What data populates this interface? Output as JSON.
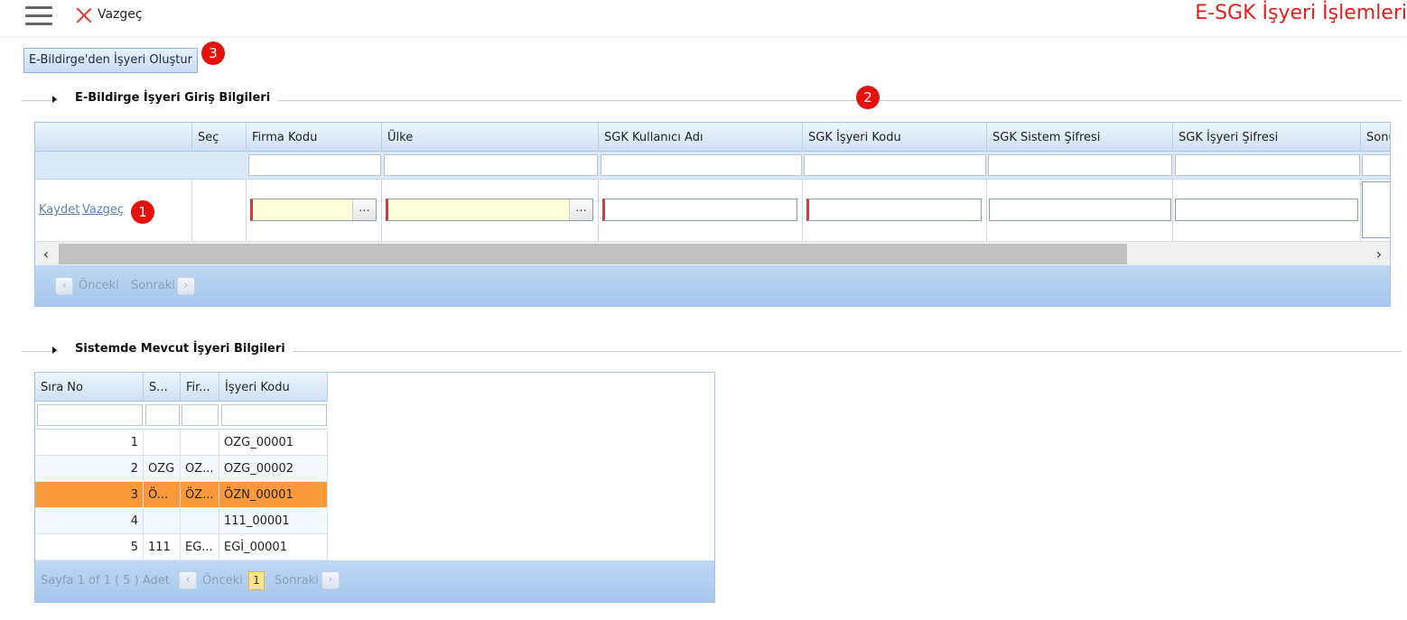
{
  "topbar": {
    "cancel_label": "Vazgeç",
    "app_title": "E-SGK İşyeri İşlemleri"
  },
  "toolbar": {
    "create_button": "E-Bildirge'den İşyeri Oluştur"
  },
  "badges": [
    "1",
    "2",
    "3"
  ],
  "section1": {
    "title": "E-Bildirge İşyeri Giriş Bilgileri",
    "columns": [
      "Seç",
      "Firma Kodu",
      "Ülke",
      "SGK Kullanıcı Adı",
      "SGK İşyeri Kodu",
      "SGK Sistem Şifresi",
      "SGK İşyeri Şifresi",
      "Sonu"
    ],
    "row_actions": {
      "save": "Kaydet",
      "cancel": "Vazgeç"
    },
    "lookup_button": "...",
    "pager": {
      "prev": "Önceki",
      "next": "Sonraki"
    }
  },
  "section2": {
    "title": "Sistemde Mevcut İşyeri Bilgileri",
    "columns": [
      "Sıra No",
      "S...",
      "Fir...",
      "İşyeri Kodu"
    ],
    "rows": [
      {
        "no": "1",
        "s": "",
        "fir": "",
        "code": "OZG_00001"
      },
      {
        "no": "2",
        "s": "OZG",
        "fir": "OZ...",
        "code": "OZG_00002"
      },
      {
        "no": "3",
        "s": "Ö...",
        "fir": "ÖZ...",
        "code": "ÖZN_00001"
      },
      {
        "no": "4",
        "s": "",
        "fir": "",
        "code": "111_00001"
      },
      {
        "no": "5",
        "s": "111",
        "fir": "EG...",
        "code": "EGİ_00001"
      }
    ],
    "selected_row": 3,
    "pager": {
      "info": "Sayfa 1 of 1 ( 5 ) Adet",
      "prev": "Önceki",
      "page": "1",
      "next": "Sonraki"
    }
  },
  "colors": {
    "accent_red": "#e0201c",
    "selected_row": "#f99a3a",
    "header_blue": "#cfe1f5"
  },
  "icons": [
    "hamburger-icon",
    "close-icon",
    "chevron-left-icon",
    "chevron-right-icon",
    "expand-arrow-icon"
  ]
}
